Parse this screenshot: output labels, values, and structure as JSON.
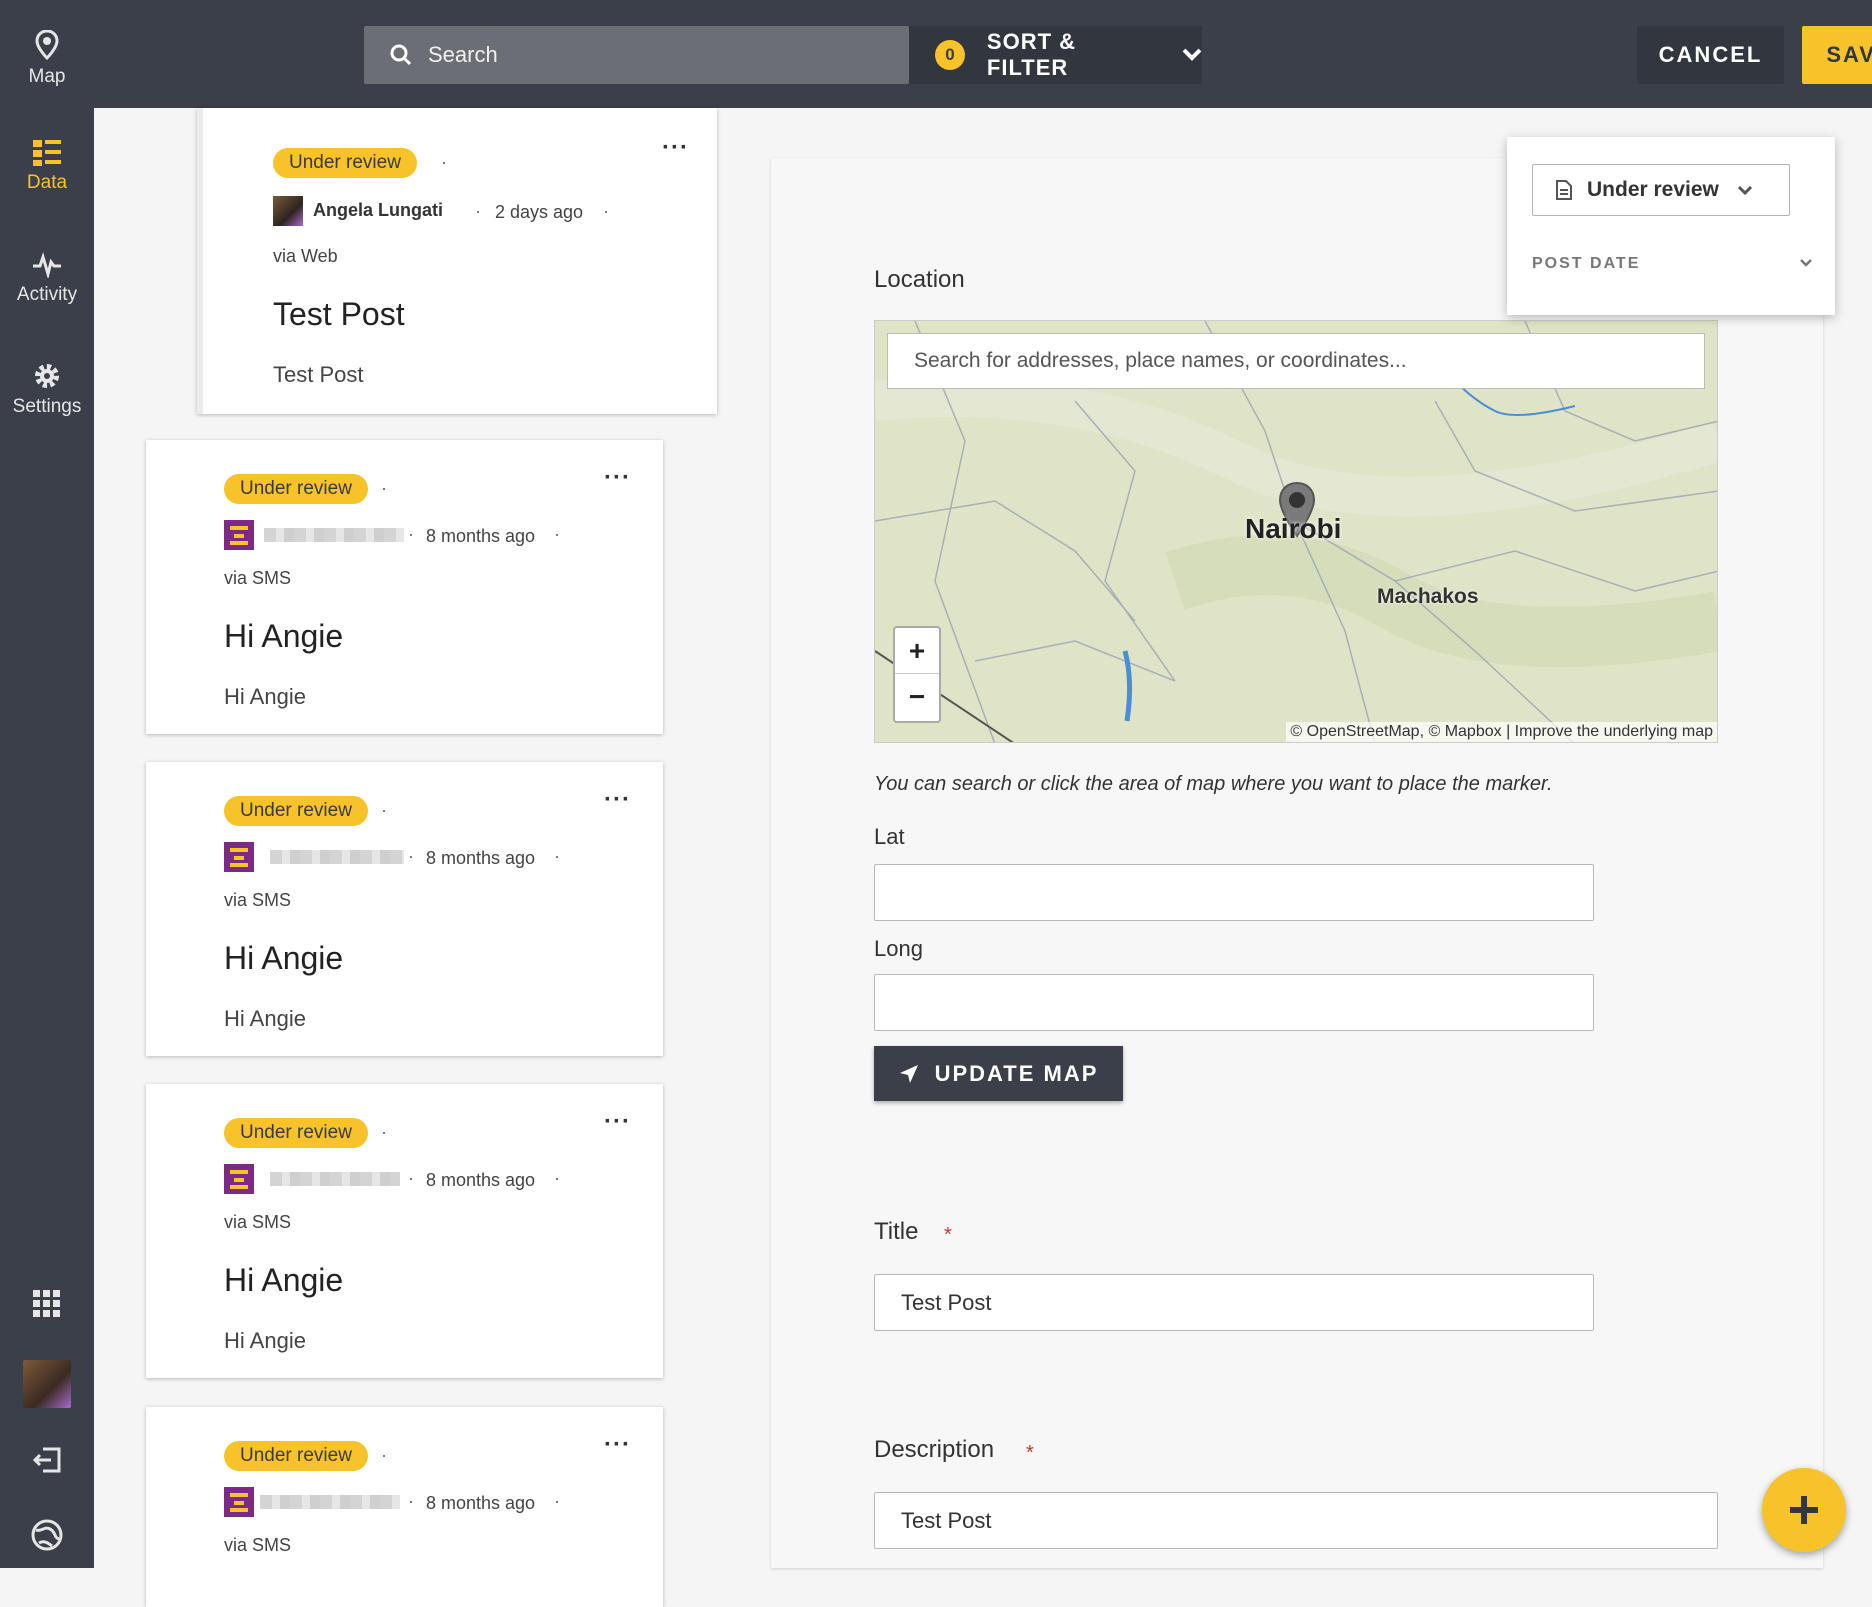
{
  "sidebar": {
    "items": [
      {
        "label": "Map",
        "icon": "map-pin-icon"
      },
      {
        "label": "Data",
        "icon": "data-list-icon",
        "active": true
      },
      {
        "label": "Activity",
        "icon": "activity-icon"
      },
      {
        "label": "Settings",
        "icon": "gear-icon"
      }
    ]
  },
  "topbar": {
    "search_placeholder": "Search",
    "filter_count": "0",
    "sort_filter_label": "SORT & FILTER",
    "cancel_label": "CANCEL",
    "save_label": "SAVE"
  },
  "posts": [
    {
      "status": "Under review",
      "author": "Angela Lungati",
      "time": "2 days ago",
      "via": "via Web",
      "title": "Test Post",
      "desc": "Test Post"
    },
    {
      "status": "Under review",
      "author": "",
      "time": "8 months ago",
      "via": "via SMS",
      "title": "Hi Angie",
      "desc": "Hi Angie"
    },
    {
      "status": "Under review",
      "author": "",
      "time": "8 months ago",
      "via": "via SMS",
      "title": "Hi Angie",
      "desc": "Hi Angie"
    },
    {
      "status": "Under review",
      "author": "",
      "time": "8 months ago",
      "via": "via SMS",
      "title": "Hi Angie",
      "desc": "Hi Angie"
    },
    {
      "status": "Under review",
      "author": "",
      "time": "8 months ago",
      "via": "via SMS",
      "title": "",
      "desc": ""
    }
  ],
  "detail": {
    "location_label": "Location",
    "map_search_placeholder": "Search for addresses, place names, or coordinates...",
    "map_city_1": "Nairobi",
    "map_city_2": "Machakos",
    "map_attribution": "© OpenStreetMap, © Mapbox | Improve the underlying map",
    "zoom_in": "+",
    "zoom_out": "−",
    "hint": "You can search or click the area of map where you want to place the marker.",
    "lat_label": "Lat",
    "lat_value": "",
    "long_label": "Long",
    "long_value": "",
    "update_map_label": "UPDATE MAP",
    "title_label": "Title",
    "title_value": "Test Post",
    "description_label": "Description",
    "description_value": "Test Post",
    "required_mark": "*"
  },
  "status_dropdown": {
    "selected": "Under review",
    "post_date_label": "POST DATE"
  },
  "colors": {
    "accent": "#f8c22a",
    "nav_bg": "#3a3f4a"
  }
}
